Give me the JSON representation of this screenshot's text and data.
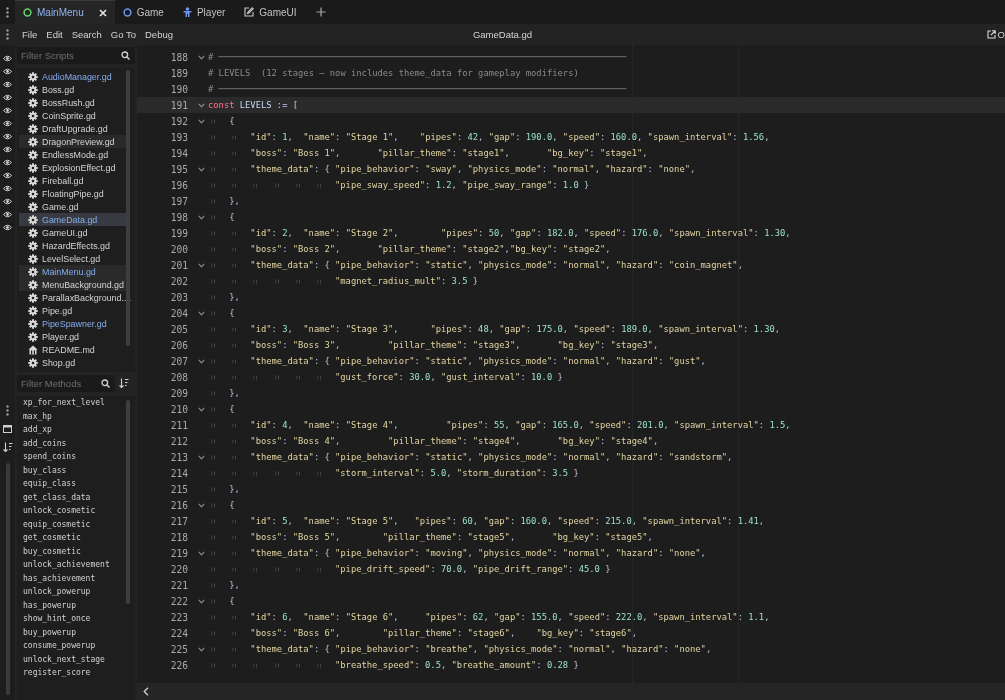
{
  "editor_tabs": [
    {
      "label": "MainMenu",
      "selected": true
    },
    {
      "label": "Game",
      "selected": false
    },
    {
      "label": "Player",
      "selected": false
    },
    {
      "label": "GameUI",
      "selected": false
    }
  ],
  "menu": [
    "File",
    "Edit",
    "Search",
    "Go To",
    "Debug"
  ],
  "file_title": "GameData.gd",
  "docs_link": "O",
  "scripts": {
    "placeholder": "Filter Scripts",
    "items": [
      {
        "name": "AudioManager.gd",
        "kind": "script",
        "selected": false,
        "shaded": false,
        "accent": true
      },
      {
        "name": "Boss.gd",
        "kind": "script",
        "selected": false,
        "shaded": false,
        "accent": false
      },
      {
        "name": "BossRush.gd",
        "kind": "script",
        "selected": false,
        "shaded": false,
        "accent": false
      },
      {
        "name": "CoinSprite.gd",
        "kind": "script",
        "selected": false,
        "shaded": false,
        "accent": false
      },
      {
        "name": "DraftUpgrade.gd",
        "kind": "script",
        "selected": false,
        "shaded": false,
        "accent": false
      },
      {
        "name": "DragonPreview.gd",
        "kind": "script",
        "selected": false,
        "shaded": true,
        "accent": false
      },
      {
        "name": "EndlessMode.gd",
        "kind": "script",
        "selected": false,
        "shaded": false,
        "accent": false
      },
      {
        "name": "ExplosionEffect.gd",
        "kind": "script",
        "selected": false,
        "shaded": false,
        "accent": false
      },
      {
        "name": "Fireball.gd",
        "kind": "script",
        "selected": false,
        "shaded": false,
        "accent": false
      },
      {
        "name": "FloatingPipe.gd",
        "kind": "script",
        "selected": false,
        "shaded": false,
        "accent": false
      },
      {
        "name": "Game.gd",
        "kind": "script",
        "selected": false,
        "shaded": false,
        "accent": false
      },
      {
        "name": "GameData.gd",
        "kind": "script",
        "selected": true,
        "shaded": false,
        "accent": true
      },
      {
        "name": "GameUI.gd",
        "kind": "script",
        "selected": false,
        "shaded": false,
        "accent": false
      },
      {
        "name": "HazardEffects.gd",
        "kind": "script",
        "selected": false,
        "shaded": false,
        "accent": false
      },
      {
        "name": "LevelSelect.gd",
        "kind": "script",
        "selected": false,
        "shaded": false,
        "accent": false
      },
      {
        "name": "MainMenu.gd",
        "kind": "script",
        "selected": false,
        "shaded": true,
        "accent": true
      },
      {
        "name": "MenuBackground.gd",
        "kind": "script",
        "selected": false,
        "shaded": true,
        "accent": false
      },
      {
        "name": "ParallaxBackground....",
        "kind": "script",
        "selected": false,
        "shaded": false,
        "accent": false
      },
      {
        "name": "Pipe.gd",
        "kind": "script",
        "selected": false,
        "shaded": false,
        "accent": false
      },
      {
        "name": "PipeSpawner.gd",
        "kind": "script",
        "selected": false,
        "shaded": false,
        "accent": true
      },
      {
        "name": "Player.gd",
        "kind": "script",
        "selected": false,
        "shaded": false,
        "accent": false
      },
      {
        "name": "README.md",
        "kind": "document",
        "selected": false,
        "shaded": false,
        "accent": false
      },
      {
        "name": "Shop.gd",
        "kind": "script",
        "selected": false,
        "shaded": false,
        "accent": false
      }
    ]
  },
  "methods": {
    "placeholder": "Filter Methods",
    "items": [
      "xp_for_next_level",
      "max_hp",
      "add_xp",
      "add_coins",
      "spend_coins",
      "buy_class",
      "equip_class",
      "get_class_data",
      "unlock_cosmetic",
      "equip_cosmetic",
      "get_cosmetic",
      "buy_cosmetic",
      "unlock_achievement",
      "has_achievement",
      "unlock_powerup",
      "has_powerup",
      "show_hint_once",
      "buy_powerup",
      "consume_powerup",
      "unlock_next_stage",
      "register_score"
    ]
  },
  "code_lines": [
    {
      "number": "188",
      "fold": true,
      "current": false,
      "text": "# ─────────────────────────────────────────────────────────────────────────────"
    },
    {
      "number": "189",
      "fold": false,
      "current": false,
      "text": "# LEVELS  (12 stages — now includes theme_data for gameplay modifiers)"
    },
    {
      "number": "190",
      "fold": false,
      "current": false,
      "text": "# ─────────────────────────────────────────────────────────────────────────────"
    },
    {
      "number": "191",
      "fold": true,
      "current": true,
      "text": "const LEVELS := ["
    },
    {
      "number": "192",
      "fold": true,
      "current": false,
      "text": "\t{"
    },
    {
      "number": "193",
      "fold": false,
      "current": false,
      "text": "\t\t\"id\": 1,  \"name\": \"Stage 1\",    \"pipes\": 42, \"gap\": 190.0, \"speed\": 160.0, \"spawn_interval\": 1.56,"
    },
    {
      "number": "194",
      "fold": false,
      "current": false,
      "text": "\t\t\"boss\": \"Boss 1\",       \"pillar_theme\": \"stage1\",       \"bg_key\": \"stage1\","
    },
    {
      "number": "195",
      "fold": true,
      "current": false,
      "text": "\t\t\"theme_data\": { \"pipe_behavior\": \"sway\", \"physics_mode\": \"normal\", \"hazard\": \"none\","
    },
    {
      "number": "196",
      "fold": false,
      "current": false,
      "text": "\t\t\t\t\t\t\"pipe_sway_speed\": 1.2, \"pipe_sway_range\": 1.0 }"
    },
    {
      "number": "197",
      "fold": false,
      "current": false,
      "text": "\t},"
    },
    {
      "number": "198",
      "fold": true,
      "current": false,
      "text": "\t{"
    },
    {
      "number": "199",
      "fold": false,
      "current": false,
      "text": "\t\t\"id\": 2,  \"name\": \"Stage 2\",        \"pipes\": 50, \"gap\": 182.0, \"speed\": 176.0, \"spawn_interval\": 1.30,"
    },
    {
      "number": "200",
      "fold": false,
      "current": false,
      "text": "\t\t\"boss\": \"Boss 2\",       \"pillar_theme\": \"stage2\",\"bg_key\": \"stage2\","
    },
    {
      "number": "201",
      "fold": true,
      "current": false,
      "text": "\t\t\"theme_data\": { \"pipe_behavior\": \"static\", \"physics_mode\": \"normal\", \"hazard\": \"coin_magnet\","
    },
    {
      "number": "202",
      "fold": false,
      "current": false,
      "text": "\t\t\t\t\t\t\"magnet_radius_mult\": 3.5 }"
    },
    {
      "number": "203",
      "fold": false,
      "current": false,
      "text": "\t},"
    },
    {
      "number": "204",
      "fold": true,
      "current": false,
      "text": "\t{"
    },
    {
      "number": "205",
      "fold": false,
      "current": false,
      "text": "\t\t\"id\": 3,  \"name\": \"Stage 3\",      \"pipes\": 48, \"gap\": 175.0, \"speed\": 189.0, \"spawn_interval\": 1.30,"
    },
    {
      "number": "206",
      "fold": false,
      "current": false,
      "text": "\t\t\"boss\": \"Boss 3\",         \"pillar_theme\": \"stage3\",       \"bg_key\": \"stage3\","
    },
    {
      "number": "207",
      "fold": true,
      "current": false,
      "text": "\t\t\"theme_data\": { \"pipe_behavior\": \"static\", \"physics_mode\": \"normal\", \"hazard\": \"gust\","
    },
    {
      "number": "208",
      "fold": false,
      "current": false,
      "text": "\t\t\t\t\t\t\"gust_force\": 30.0, \"gust_interval\": 10.0 }"
    },
    {
      "number": "209",
      "fold": false,
      "current": false,
      "text": "\t},"
    },
    {
      "number": "210",
      "fold": true,
      "current": false,
      "text": "\t{"
    },
    {
      "number": "211",
      "fold": false,
      "current": false,
      "text": "\t\t\"id\": 4,  \"name\": \"Stage 4\",         \"pipes\": 55, \"gap\": 165.0, \"speed\": 201.0, \"spawn_interval\": 1.5,"
    },
    {
      "number": "212",
      "fold": false,
      "current": false,
      "text": "\t\t\"boss\": \"Boss 4\",         \"pillar_theme\": \"stage4\",       \"bg_key\": \"stage4\","
    },
    {
      "number": "213",
      "fold": true,
      "current": false,
      "text": "\t\t\"theme_data\": { \"pipe_behavior\": \"static\", \"physics_mode\": \"normal\", \"hazard\": \"sandstorm\","
    },
    {
      "number": "214",
      "fold": false,
      "current": false,
      "text": "\t\t\t\t\t\t\"storm_interval\": 5.0, \"storm_duration\": 3.5 }"
    },
    {
      "number": "215",
      "fold": false,
      "current": false,
      "text": "\t},"
    },
    {
      "number": "216",
      "fold": true,
      "current": false,
      "text": "\t{"
    },
    {
      "number": "217",
      "fold": false,
      "current": false,
      "text": "\t\t\"id\": 5,  \"name\": \"Stage 5\",   \"pipes\": 60, \"gap\": 160.0, \"speed\": 215.0, \"spawn_interval\": 1.41,"
    },
    {
      "number": "218",
      "fold": false,
      "current": false,
      "text": "\t\t\"boss\": \"Boss 5\",        \"pillar_theme\": \"stage5\",       \"bg_key\": \"stage5\","
    },
    {
      "number": "219",
      "fold": true,
      "current": false,
      "text": "\t\t\"theme_data\": { \"pipe_behavior\": \"moving\", \"physics_mode\": \"normal\", \"hazard\": \"none\","
    },
    {
      "number": "220",
      "fold": false,
      "current": false,
      "text": "\t\t\t\t\t\t\"pipe_drift_speed\": 70.0, \"pipe_drift_range\": 45.0 }"
    },
    {
      "number": "221",
      "fold": false,
      "current": false,
      "text": "\t},"
    },
    {
      "number": "222",
      "fold": true,
      "current": false,
      "text": "\t{"
    },
    {
      "number": "223",
      "fold": false,
      "current": false,
      "text": "\t\t\"id\": 6,  \"name\": \"Stage 6\",     \"pipes\": 62, \"gap\": 155.0, \"speed\": 222.0, \"spawn_interval\": 1.1,"
    },
    {
      "number": "224",
      "fold": false,
      "current": false,
      "text": "\t\t\"boss\": \"Boss 6\",        \"pillar_theme\": \"stage6\",    \"bg_key\": \"stage6\","
    },
    {
      "number": "225",
      "fold": true,
      "current": false,
      "text": "\t\t\"theme_data\": { \"pipe_behavior\": \"breathe\", \"physics_mode\": \"normal\", \"hazard\": \"none\","
    },
    {
      "number": "226",
      "fold": false,
      "current": false,
      "text": "\t\t\t\t\t\t\"breathe_speed\": 0.5, \"breathe_amount\": 0.28 }"
    }
  ]
}
